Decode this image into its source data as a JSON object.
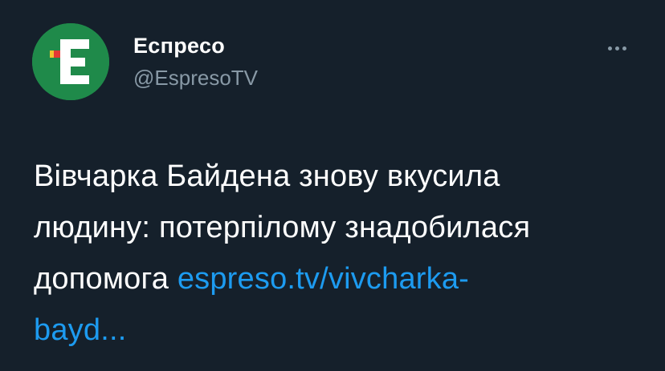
{
  "author": {
    "display_name": "Еспресо",
    "handle": "@EspresoTV",
    "avatar_letter": "E"
  },
  "more_icon": "more-horizontal-icon",
  "tweet": {
    "line1": "Вівчарка Байдена знову вкусила",
    "line2": "людину: потерпілому знадобилася",
    "line3_text": "допомога",
    "link_part1": "espreso.tv/vivcharka-",
    "link_part2": "bayd..."
  },
  "colors": {
    "background": "#15202b",
    "link": "#1d9bf0",
    "secondary_text": "#8899a6",
    "avatar_green": "#1f8a4a"
  }
}
